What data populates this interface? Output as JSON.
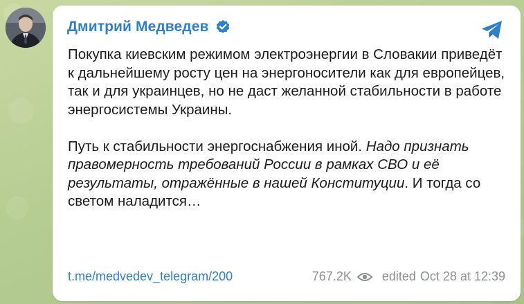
{
  "channel": {
    "name": "Дмитрий Медведев",
    "verified": true,
    "avatar_icon": "user-portrait-icon"
  },
  "message": {
    "paragraph1": "Покупка киевским режимом электроэнергии в Словакии приведёт к дальнейшему росту цен на энергоносители как для европейцев, так и для украинцев, но не даст желанной стабильности в работе энергосистемы Украины.",
    "paragraph2_plain": "Путь к стабильности энергоснабжения иной. ",
    "paragraph2_italic": "Надо признать правомерность требований России в рамках СВО и её результаты, отражённые в нашей Конституции",
    "paragraph2_tail": ". И тогда со светом наладится…"
  },
  "footer": {
    "link": "t.me/medvedev_telegram/200",
    "views": "767.2K",
    "views_icon": "eye-icon",
    "edited": "edited",
    "timestamp": "Oct 28 at 12:39"
  },
  "share_icon": "telegram-share-icon",
  "colors": {
    "accent": "#2f80c7",
    "background": "#b9cf98",
    "bubble": "#ffffff",
    "text": "#1c1c1c",
    "muted": "#8c8f93"
  }
}
